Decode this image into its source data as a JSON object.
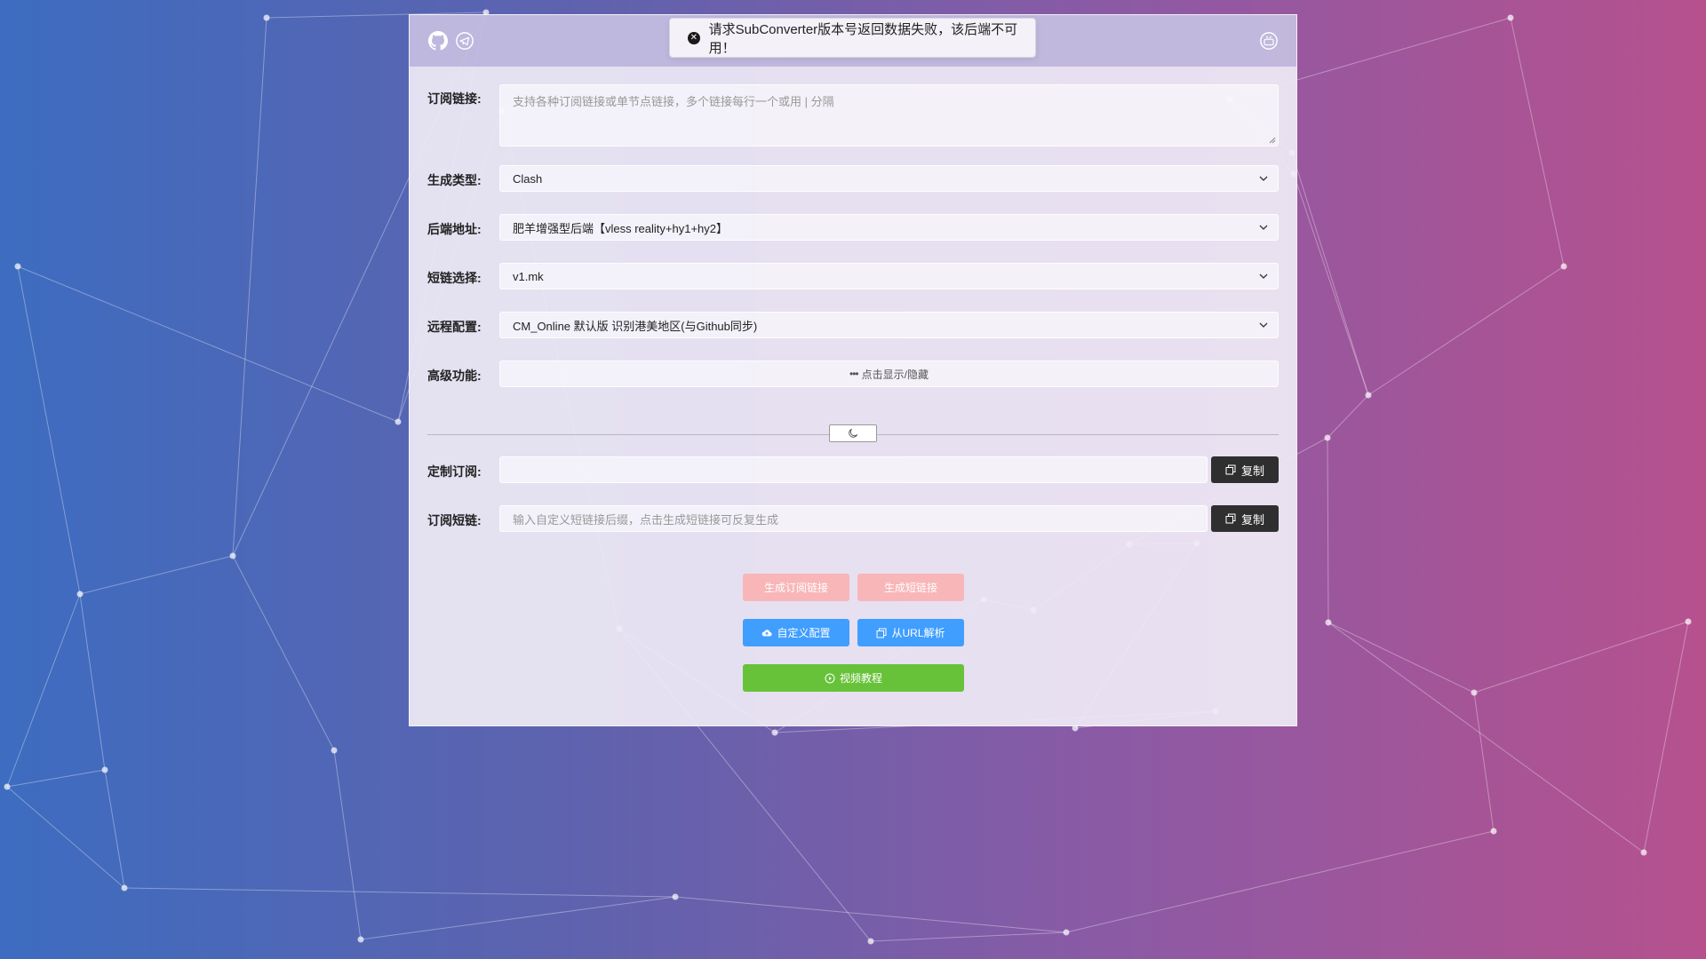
{
  "toast": {
    "message": "请求SubConverter版本号返回数据失败，该后端不可用！",
    "icon": "close-circle-icon"
  },
  "header": {
    "icons": [
      "github-icon",
      "telegram-icon",
      "youtube-icon"
    ]
  },
  "form": {
    "subscription_link": {
      "label": "订阅链接:",
      "placeholder": "支持各种订阅链接或单节点链接，多个链接每行一个或用 | 分隔"
    },
    "target_type": {
      "label": "生成类型:",
      "value": "Clash"
    },
    "backend": {
      "label": "后端地址:",
      "value": "肥羊增强型后端【vless reality+hy1+hy2】"
    },
    "short_url": {
      "label": "短链选择:",
      "value": "v1.mk"
    },
    "remote_config": {
      "label": "远程配置:",
      "value": "CM_Online 默认版 识别港美地区(与Github同步)"
    },
    "advanced": {
      "label": "高级功能:",
      "toggle_text": "点击显示/隐藏"
    }
  },
  "output": {
    "custom_sub": {
      "label": "定制订阅:",
      "value": "",
      "copy_label": "复制"
    },
    "short_sub": {
      "label": "订阅短链:",
      "placeholder": "输入自定义短链接后缀，点击生成短链接可反复生成",
      "copy_label": "复制"
    }
  },
  "buttons": {
    "generate_sub": "生成订阅链接",
    "generate_short": "生成短链接",
    "custom_config": "自定义配置",
    "parse_url": "从URL解析",
    "video_tutorial": "视频教程"
  },
  "colors": {
    "pink": "#f9b6b8",
    "blue": "#409eff",
    "green": "#67c23a",
    "dark": "#2f2f2f"
  }
}
